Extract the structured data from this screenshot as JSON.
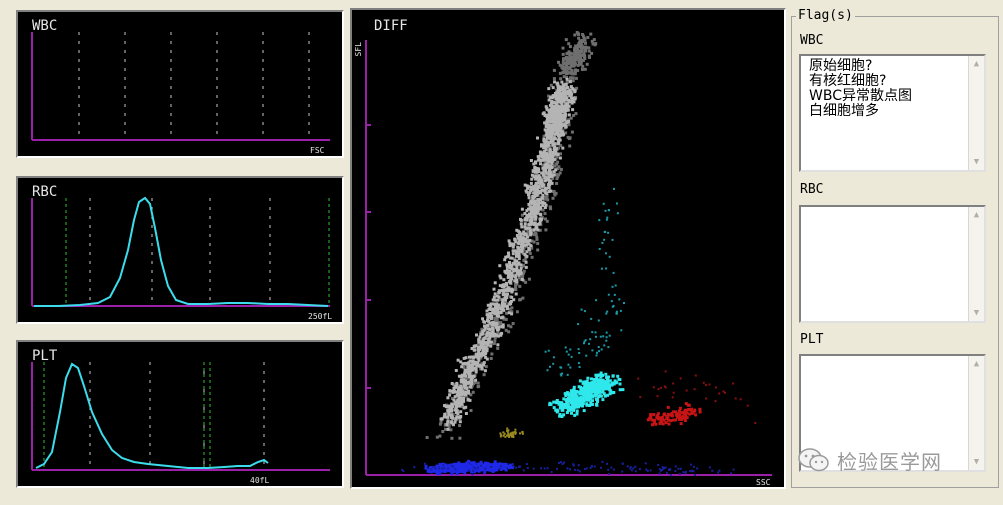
{
  "panels": {
    "wbc": {
      "title": "WBC",
      "axis_label": "FSC"
    },
    "rbc": {
      "title": "RBC",
      "axis_label": "250fL"
    },
    "plt": {
      "title": "PLT",
      "axis_label": "40fL"
    },
    "diff": {
      "title": "DIFF",
      "x_axis_label": "SSC",
      "y_axis_label": "SFL"
    }
  },
  "flags": {
    "legend": "Flag(s)",
    "wbc": {
      "label": "WBC",
      "items": [
        "原始细胞?",
        "有核红细胞?",
        "WBC异常散点图",
        "白细胞增多"
      ]
    },
    "rbc": {
      "label": "RBC",
      "items": []
    },
    "plt": {
      "label": "PLT",
      "items": []
    }
  },
  "watermark": {
    "text": "检验医学网",
    "icon": "wechat-icon"
  },
  "colors": {
    "panel_bg": "#000000",
    "axis": "#9b20a8",
    "curve": "#3cdcec",
    "gate_line": "#30c030",
    "grid": "#c8c8c8",
    "scatter_gray": "#b4b4b4",
    "scatter_cyan": "#2ee8ec",
    "scatter_red": "#c81414",
    "scatter_blue": "#1e28e6",
    "scatter_olive": "#9a8a20"
  }
}
